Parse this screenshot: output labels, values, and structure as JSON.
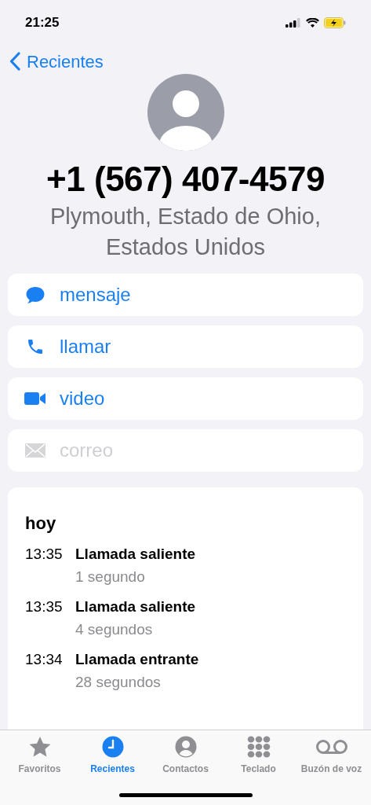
{
  "status_bar": {
    "time": "21:25"
  },
  "nav": {
    "back_label": "Recientes"
  },
  "contact": {
    "number": "+1 (567) 407-4579",
    "location": "Plymouth, Estado de Ohio, Estados Unidos"
  },
  "actions": [
    {
      "kind": "message",
      "label": "mensaje",
      "disabled": false
    },
    {
      "kind": "call",
      "label": "llamar",
      "disabled": false
    },
    {
      "kind": "video",
      "label": "video",
      "disabled": false
    },
    {
      "kind": "mail",
      "label": "correo",
      "disabled": true
    }
  ],
  "call_log": {
    "heading": "hoy",
    "entries": [
      {
        "time": "13:35",
        "type": "Llamada saliente",
        "duration": "1 segundo"
      },
      {
        "time": "13:35",
        "type": "Llamada saliente",
        "duration": "4 segundos"
      },
      {
        "time": "13:34",
        "type": "Llamada entrante",
        "duration": "28 segundos"
      }
    ]
  },
  "tab_bar": [
    {
      "kind": "favorites",
      "label": "Favoritos",
      "selected": false
    },
    {
      "kind": "recents",
      "label": "Recientes",
      "selected": true
    },
    {
      "kind": "contacts",
      "label": "Contactos",
      "selected": false
    },
    {
      "kind": "keypad",
      "label": "Teclado",
      "selected": false
    },
    {
      "kind": "voicemail",
      "label": "Buzón de voz",
      "selected": false
    }
  ]
}
